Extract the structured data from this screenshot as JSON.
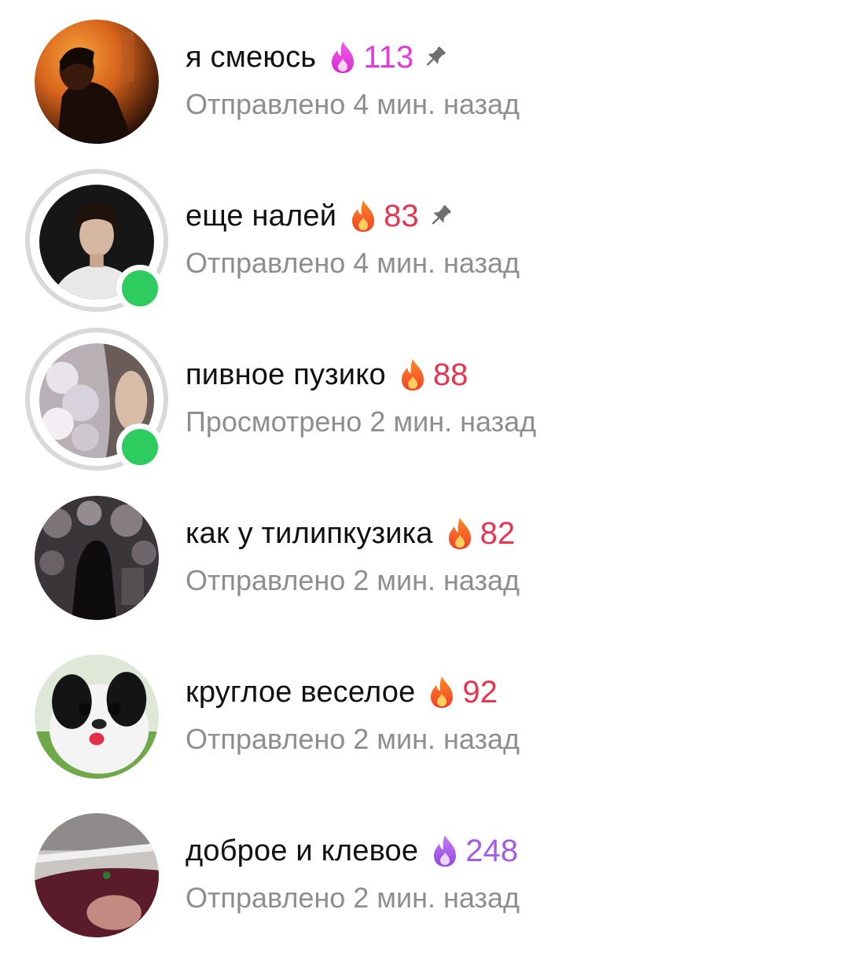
{
  "colors": {
    "pink_streak": "#e23ad6",
    "red_streak": "#e8344f",
    "purple_streak": "#a35be8",
    "online": "#2ecc5f",
    "secondary_text": "#8e8e8e"
  },
  "chats": [
    {
      "name": "я смеюсь",
      "streak_count": "113",
      "streak_icon": "pink-fire-icon",
      "pinned": true,
      "online": false,
      "status": "Отправлено 4 мин. назад"
    },
    {
      "name": "еще налей",
      "streak_count": "83",
      "streak_icon": "fire-icon",
      "pinned": true,
      "online": true,
      "status": "Отправлено 4 мин. назад"
    },
    {
      "name": "пивное пузико",
      "streak_count": "88",
      "streak_icon": "fire-icon",
      "pinned": false,
      "online": true,
      "status": "Просмотрено 2 мин. назад"
    },
    {
      "name": "как у тилипкузика",
      "streak_count": "82",
      "streak_icon": "fire-icon",
      "pinned": false,
      "online": false,
      "status": "Отправлено 2 мин. назад"
    },
    {
      "name": "круглое веселое",
      "streak_count": "92",
      "streak_icon": "fire-icon",
      "pinned": false,
      "online": false,
      "status": "Отправлено 2 мин. назад"
    },
    {
      "name": "доброе и клевое",
      "streak_count": "248",
      "streak_icon": "purple-fire-icon",
      "pinned": false,
      "online": false,
      "status": "Отправлено 2 мин. назад"
    }
  ]
}
